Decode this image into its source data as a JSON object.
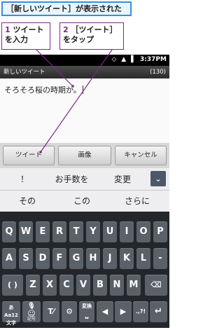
{
  "caption": "［新しいツイート］が表示された",
  "callouts": [
    {
      "num": "1",
      "text": "ツイートを入力"
    },
    {
      "num": "2",
      "text": "［ツイート］をタップ"
    }
  ],
  "status": {
    "icons": "◇ ▲ ▌",
    "time": "3:37PM"
  },
  "compose": {
    "title": "新しいツイート",
    "remaining": "(130)",
    "text": "そろそろ桜の時期か。"
  },
  "actions": {
    "tweet": "ツイート",
    "image": "画像",
    "cancel": "キャンセル"
  },
  "suggestions": {
    "row1": [
      "！",
      "お手数を",
      "変更"
    ],
    "row2": [
      "その",
      "この",
      "さらに"
    ],
    "expand_icon": "chevron-down-icon"
  },
  "keyboard": {
    "row1": [
      "Q",
      "W",
      "E",
      "R",
      "T",
      "Y",
      "U",
      "I",
      "O",
      "P"
    ],
    "row2": [
      "A",
      "S",
      "D",
      "F",
      "G",
      "H",
      "J",
      "K",
      "L",
      "-"
    ],
    "row3": [
      "( )",
      "Z",
      "X",
      "C",
      "V",
      "B",
      "N",
      "M"
    ],
    "backspace": "⌫",
    "row4": {
      "mode_top": "あAa12",
      "mode_bottom": "文字",
      "mic": "🎙",
      "emoji": "☺",
      "emoji_label": "記号",
      "text_tool": "T⁄",
      "settings": "⚙",
      "convert_label": "変換",
      "convert_space": "⎵",
      "left": "◀",
      "right": "▶",
      "punct": ".,?!",
      "enter": "↵"
    }
  }
}
